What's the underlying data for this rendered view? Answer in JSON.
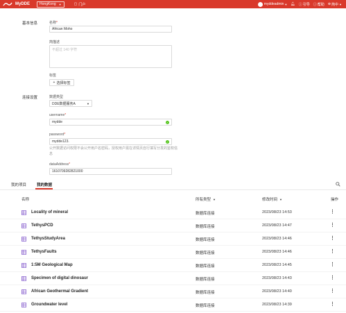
{
  "colors": {
    "brand": "#d9392b",
    "success": "#52c41a"
  },
  "topbar": {
    "brand": "MyDDE",
    "region": "HongKong",
    "portal": "门户",
    "user": "myddeadmin",
    "guide": "引导",
    "help": "帮助",
    "lang": "简中"
  },
  "form": {
    "basic_section": "基本信息",
    "name_label": "名称",
    "name_value": "African Moho",
    "desc_label": "简描述",
    "desc_placeholder": "不超过 140 字符",
    "tags_label": "标签",
    "tags_button": "选择标签",
    "conn_section": "连接设置",
    "dtype_label": "数据类型",
    "dtype_value": "DDE数据服务A",
    "username_label": "username",
    "username_value": "mydde",
    "password_label": "password",
    "password_value": "mydde123.",
    "hint": "公开数据访问权限不会公开用户名密码，授权用户需在详情页自行填写分发的鉴权信息",
    "address_label": "dataAddress",
    "address_value": "1610709282821000"
  },
  "tabs": [
    {
      "label": "我的项目"
    },
    {
      "label": "我的数据"
    }
  ],
  "table": {
    "headers": {
      "name": "名称",
      "type": "所有类型",
      "time": "修改时间",
      "actions": "操作"
    },
    "rows": [
      {
        "name": "Locality of mineral",
        "type": "数据库连接",
        "time": "2023/08/23 14:53"
      },
      {
        "name": "TethysPCD",
        "type": "数据库连接",
        "time": "2023/08/23 14:47"
      },
      {
        "name": "TethysStudyArea",
        "type": "数据库连接",
        "time": "2023/08/23 14:46"
      },
      {
        "name": "TethysFaults",
        "type": "数据库连接",
        "time": "2023/08/23 14:46"
      },
      {
        "name": "1:5M Geological Map",
        "type": "数据库连接",
        "time": "2023/08/23 14:45"
      },
      {
        "name": "Specimen of digital dinosaur",
        "type": "数据库连接",
        "time": "2023/08/23 14:43"
      },
      {
        "name": "African Geothermal Gradient",
        "type": "数据库连接",
        "time": "2023/08/23 14:40"
      },
      {
        "name": "Groundwater level",
        "type": "数据库连接",
        "time": "2023/08/23 14:39"
      }
    ]
  }
}
